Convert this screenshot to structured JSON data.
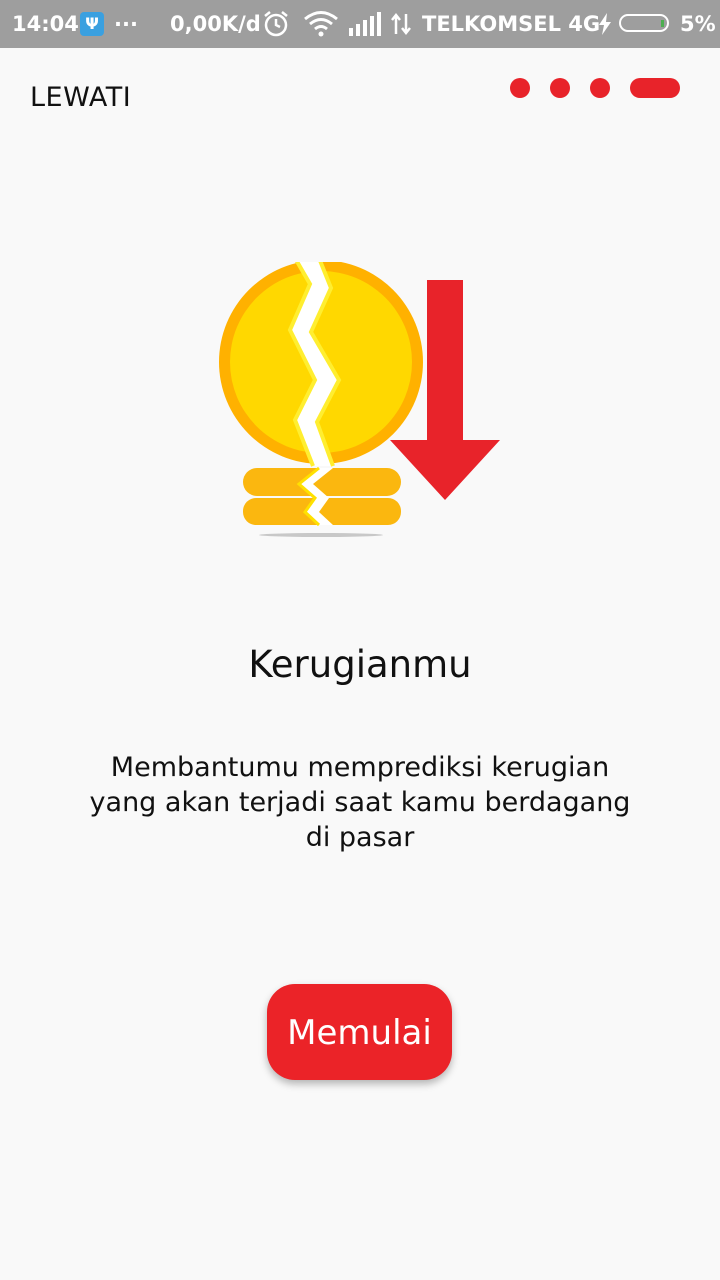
{
  "status_bar": {
    "time": "14:04",
    "notification_icon": "usb-icon",
    "more": "...",
    "speed": "0,00K/d",
    "alarm_icon": "alarm-icon",
    "wifi_icon": "wifi-icon",
    "signal_icon": "signal-icon",
    "data_icon": "data-arrows-icon",
    "carrier": "TELKOMSEL 4G",
    "charging_icon": "bolt-icon",
    "battery_icon": "battery-icon",
    "battery_percent": "5%"
  },
  "header": {
    "skip_label": "LEWATI",
    "pager": {
      "total": 4,
      "active_index": 3,
      "color": "#e8232a"
    }
  },
  "illustration": {
    "name": "broken-coin-down-arrow-icon"
  },
  "content": {
    "title": "Kerugianmu",
    "description": "Membantumu memprediksi kerugian yang akan terjadi saat kamu berdagang di pasar"
  },
  "cta": {
    "label": "Memulai",
    "color": "#eb2328"
  }
}
